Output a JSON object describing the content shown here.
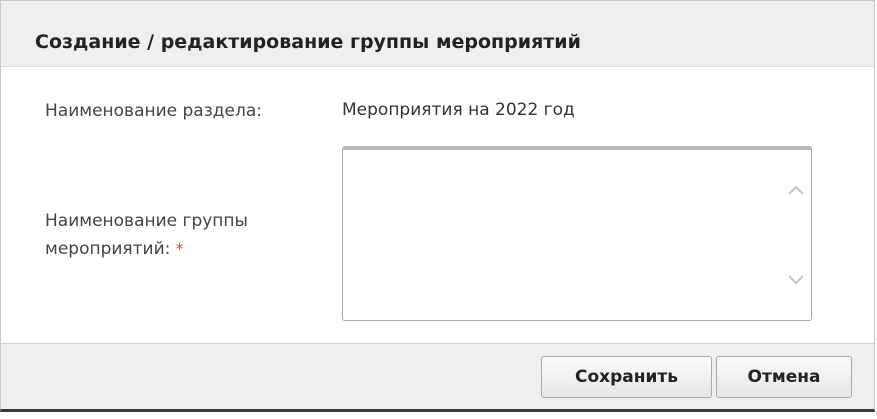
{
  "dialog": {
    "title": "Создание / редактирование группы мероприятий"
  },
  "form": {
    "section_label": "Наименование раздела:",
    "section_value": "Мероприятия на 2022 год",
    "group_label_line1": "Наименование группы",
    "group_label_line2": "мероприятий:",
    "required_mark": "*",
    "group_value": ""
  },
  "buttons": {
    "save_label": "Сохранить",
    "cancel_label": "Отмена"
  },
  "icons": {
    "scroll_up": "chevron-up-icon",
    "scroll_down": "chevron-down-icon"
  },
  "colors": {
    "required": "#e0453d",
    "header_bg": "#efefef"
  }
}
